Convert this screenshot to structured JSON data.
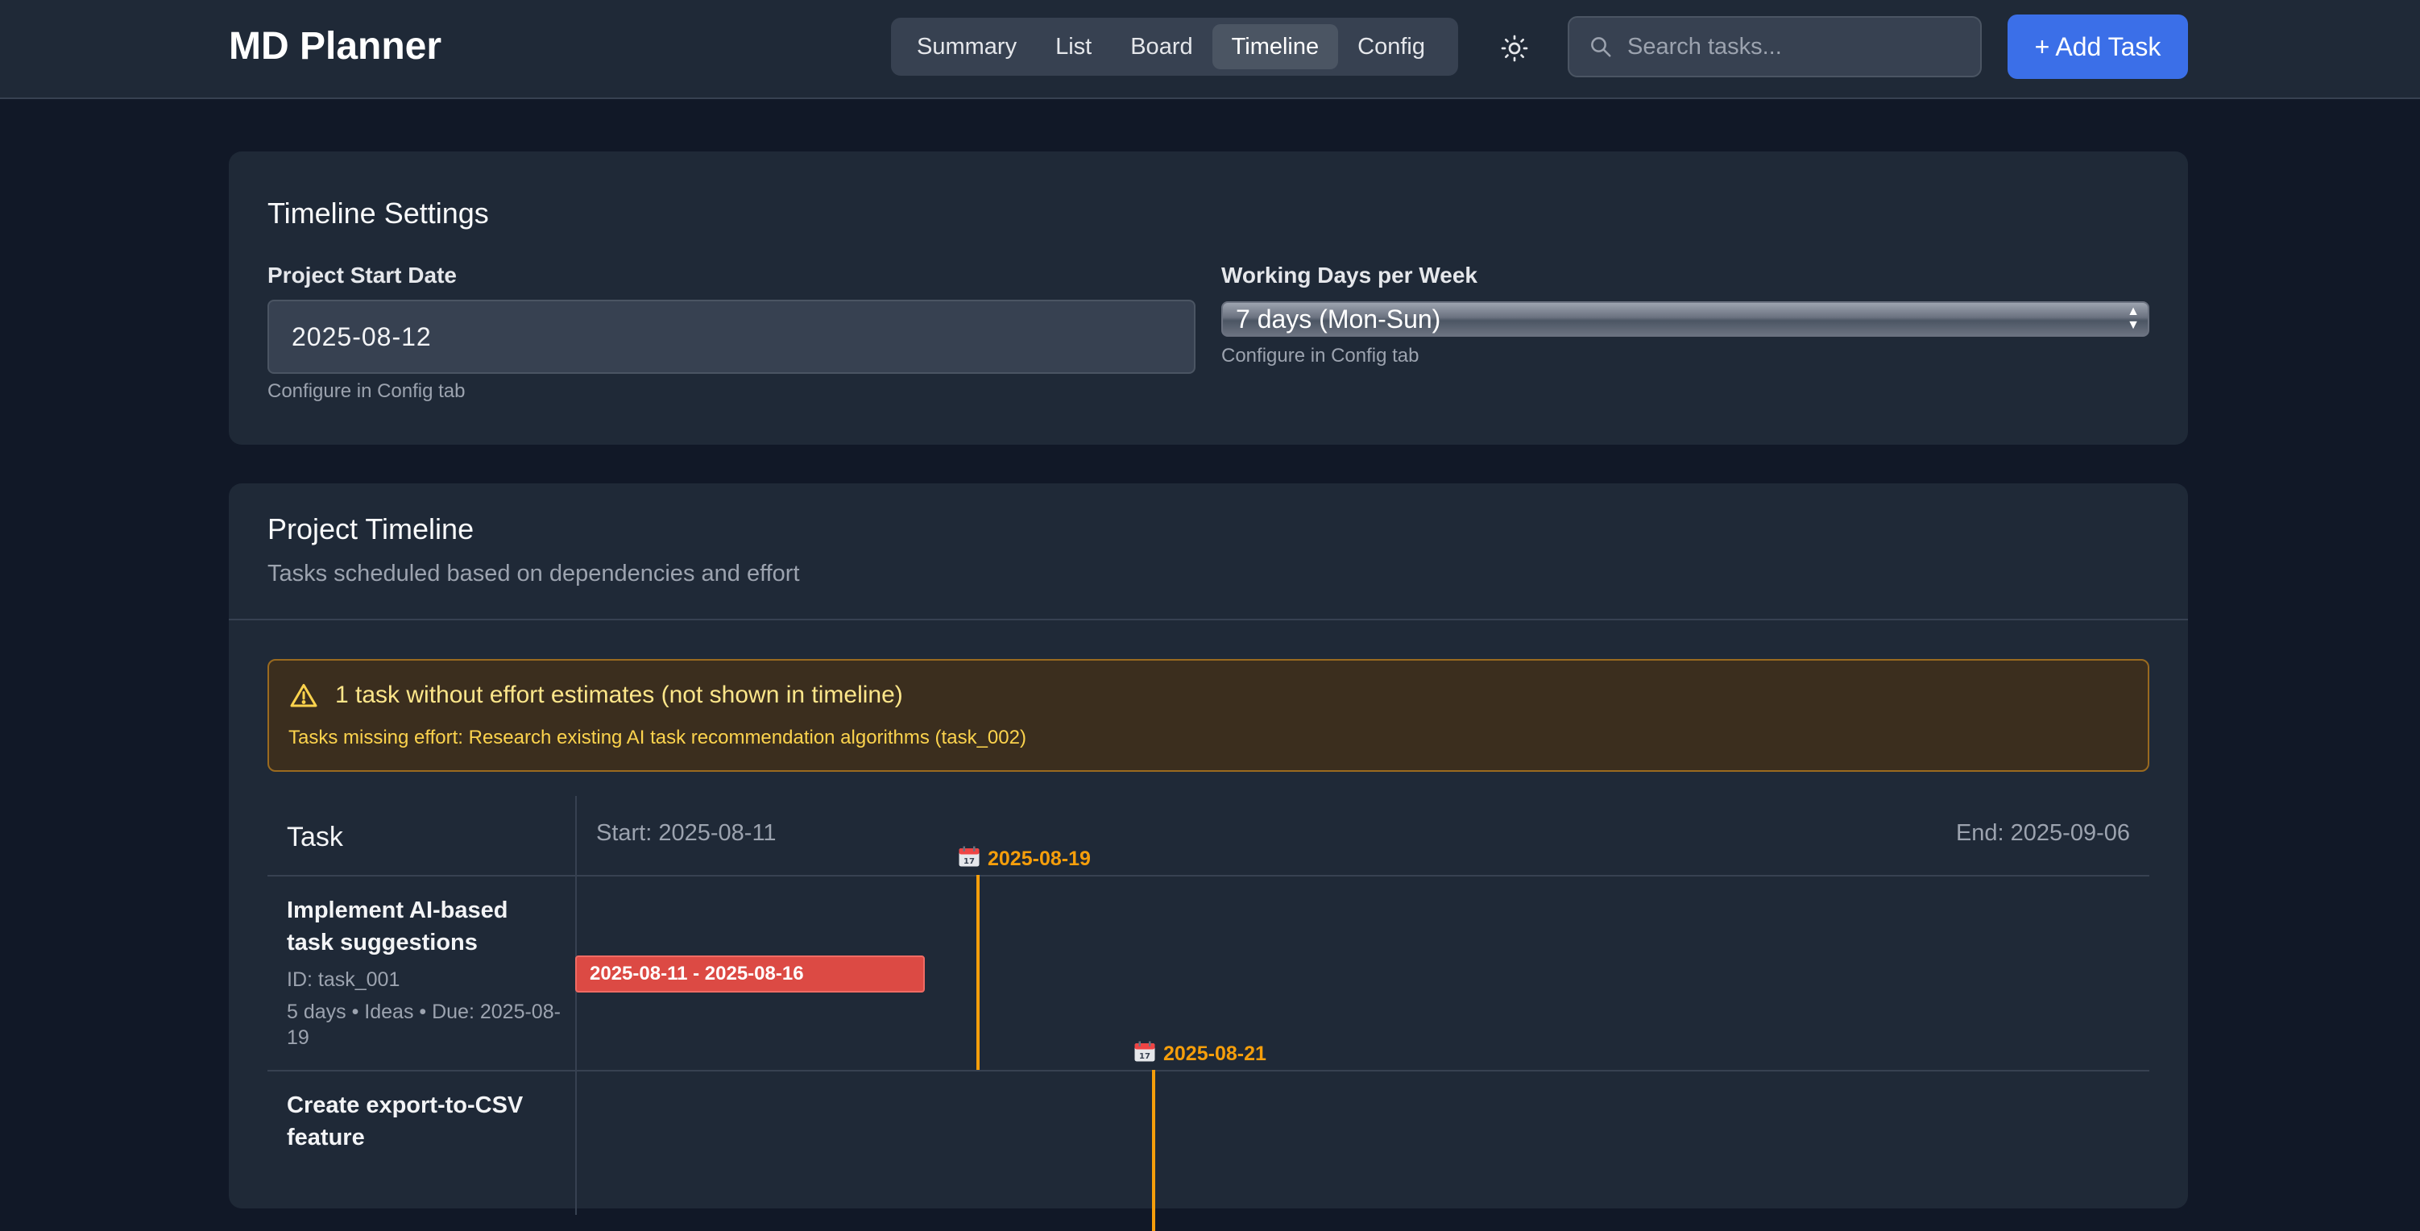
{
  "app": {
    "title": "MD Planner"
  },
  "nav": {
    "tabs": [
      {
        "label": "Summary"
      },
      {
        "label": "List"
      },
      {
        "label": "Board"
      },
      {
        "label": "Timeline",
        "active": true
      },
      {
        "label": "Config"
      }
    ]
  },
  "header": {
    "theme_icon": "sun-icon",
    "search_placeholder": "Search tasks...",
    "add_label": "+ Add Task"
  },
  "settings": {
    "title": "Timeline Settings",
    "start_date_label": "Project Start Date",
    "start_date_value": "2025-08-12",
    "start_date_hint": "Configure in Config tab",
    "working_days_label": "Working Days per Week",
    "working_days_value": "7 days (Mon-Sun)",
    "working_days_hint": "Configure in Config tab"
  },
  "timeline": {
    "title": "Project Timeline",
    "subtitle": "Tasks scheduled based on dependencies and effort",
    "warning": {
      "title": "1 task without effort estimates (not shown in timeline)",
      "text": "Tasks missing effort: Research existing AI task recommendation algorithms (task_002)"
    },
    "gantt": {
      "task_header": "Task",
      "start_label": "Start: 2025-08-11",
      "end_label": "End: 2025-09-06",
      "tasks": [
        {
          "name": "Implement AI-based task suggestions",
          "id": "ID: task_001",
          "meta": "5 days • Ideas • Due: 2025-08-19",
          "bar_label": "2025-08-11 - 2025-08-16",
          "due_label": "2025-08-19"
        },
        {
          "name": "Create export-to-CSV feature",
          "due_label": "2025-08-21"
        }
      ]
    }
  },
  "colors": {
    "background": "#111827",
    "card": "#1f2937",
    "accent": "#3b6fe8",
    "bar": "#dc4a44",
    "milestone": "#f59e0b",
    "warning_text": "#fde68a"
  }
}
